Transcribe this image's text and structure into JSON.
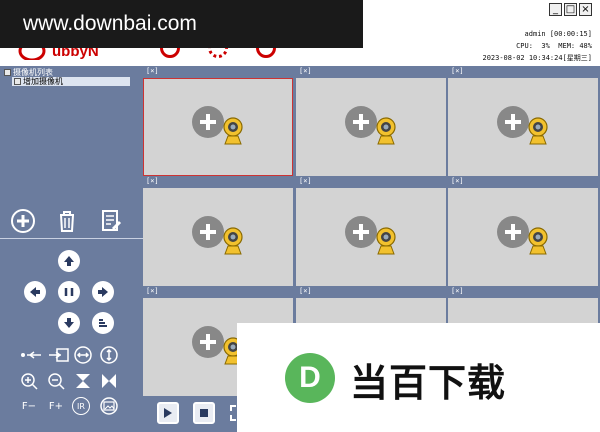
{
  "watermark": {
    "text": "www.downbai.com"
  },
  "window": {
    "minimize": "_",
    "maximize": "□",
    "close": "×"
  },
  "status": {
    "user": "admin",
    "timer": "[00:00:15]",
    "cpu_label": "CPU:",
    "cpu_value": "3%",
    "mem_label": "MEM:",
    "mem_value": "48%",
    "datetime": "2023-08-02 10:34:24[星期三]"
  },
  "logo": {
    "text": "ubbyN"
  },
  "tree": {
    "root_label": "摄像机列表",
    "child_label": "增加摄像机"
  },
  "grid": {
    "cell_header": "[×]",
    "rows": 3,
    "cols": 3
  },
  "controls": {
    "focus_minus": "F−",
    "focus_plus": "F+",
    "ir": "IR"
  },
  "ad": {
    "logo_letter": "D",
    "text": "当百下载"
  },
  "colors": {
    "panel": "#6b7c9e",
    "cell": "#d3d3d3",
    "selected_border": "#cc3333",
    "ad_green": "#59b65b"
  }
}
